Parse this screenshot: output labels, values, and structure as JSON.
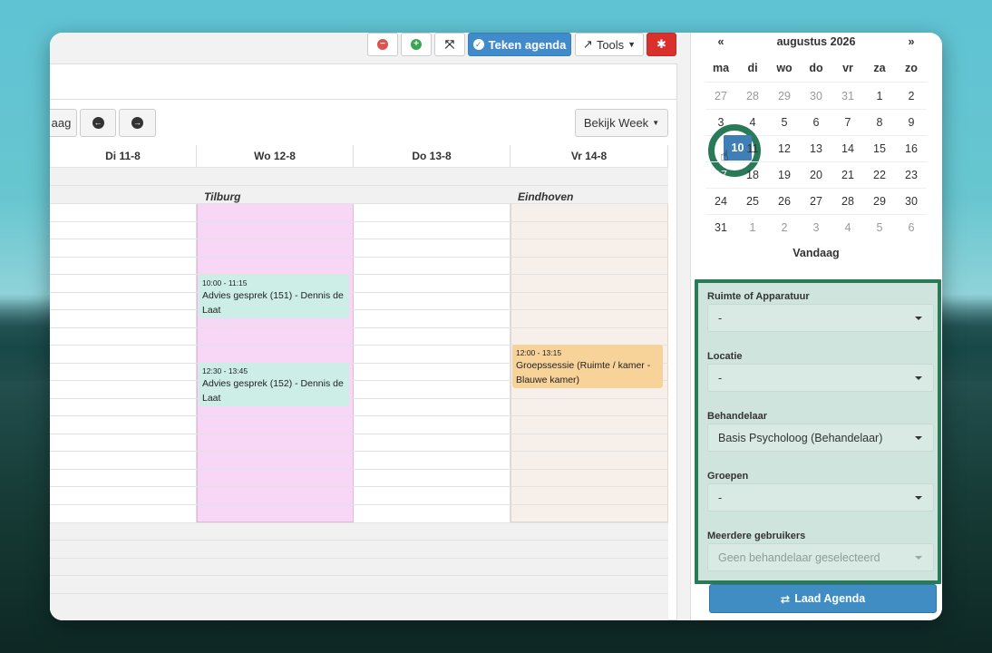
{
  "toolbar": {
    "teken_agenda": "Teken agenda",
    "tools": "Tools"
  },
  "nav": {
    "today_partial": "aag",
    "bekijk_week": "Bekijk Week"
  },
  "calendar": {
    "days": [
      "Di 11-8",
      "Wo 12-8",
      "Do 13-8",
      "Vr 14-8"
    ],
    "locations": {
      "wo": "Tilburg",
      "vr": "Eindhoven"
    },
    "events": [
      {
        "time": "10:00 - 11:15",
        "title": "Advies gesprek (151) - Dennis de Laat"
      },
      {
        "time": "12:30 - 13:45",
        "title": "Advies gesprek (152) - Dennis de Laat"
      },
      {
        "time": "12:00 - 13:15",
        "title": "Groepssessie (Ruimte / kamer - Blauwe kamer)"
      }
    ]
  },
  "minical": {
    "prev": "«",
    "next": "»",
    "month": "augustus 2026",
    "weekdays": [
      "ma",
      "di",
      "wo",
      "do",
      "vr",
      "za",
      "zo"
    ],
    "weeks": [
      [
        "27",
        "28",
        "29",
        "30",
        "31",
        "1",
        "2"
      ],
      [
        "3",
        "4",
        "5",
        "6",
        "7",
        "8",
        "9"
      ],
      [
        "10",
        "11",
        "12",
        "13",
        "14",
        "15",
        "16"
      ],
      [
        "17",
        "18",
        "19",
        "20",
        "21",
        "22",
        "23"
      ],
      [
        "24",
        "25",
        "26",
        "27",
        "28",
        "29",
        "30"
      ],
      [
        "31",
        "1",
        "2",
        "3",
        "4",
        "5",
        "6"
      ]
    ],
    "selected": "10",
    "today": "Vandaag"
  },
  "filters": {
    "ruimte_label": "Ruimte of Apparatuur",
    "ruimte_value": "-",
    "locatie_label": "Locatie",
    "locatie_value": "-",
    "behandelaar_label": "Behandelaar",
    "behandelaar_value": "Basis Psycholoog (Behandelaar)",
    "groepen_label": "Groepen",
    "groepen_value": "-",
    "meerdere_label": "Meerdere gebruikers",
    "meerdere_value": "Geen behandelaar geselecteerd"
  },
  "load_button": "Laad Agenda",
  "colors": {
    "accent_blue": "#428bca",
    "danger_red": "#d9302c",
    "highlight_green": "#2a7a5a",
    "event_green": "#cdeee6",
    "event_orange": "#f7d39a",
    "wo_column": "#f8d6f5",
    "vr_column": "#f7efea"
  }
}
